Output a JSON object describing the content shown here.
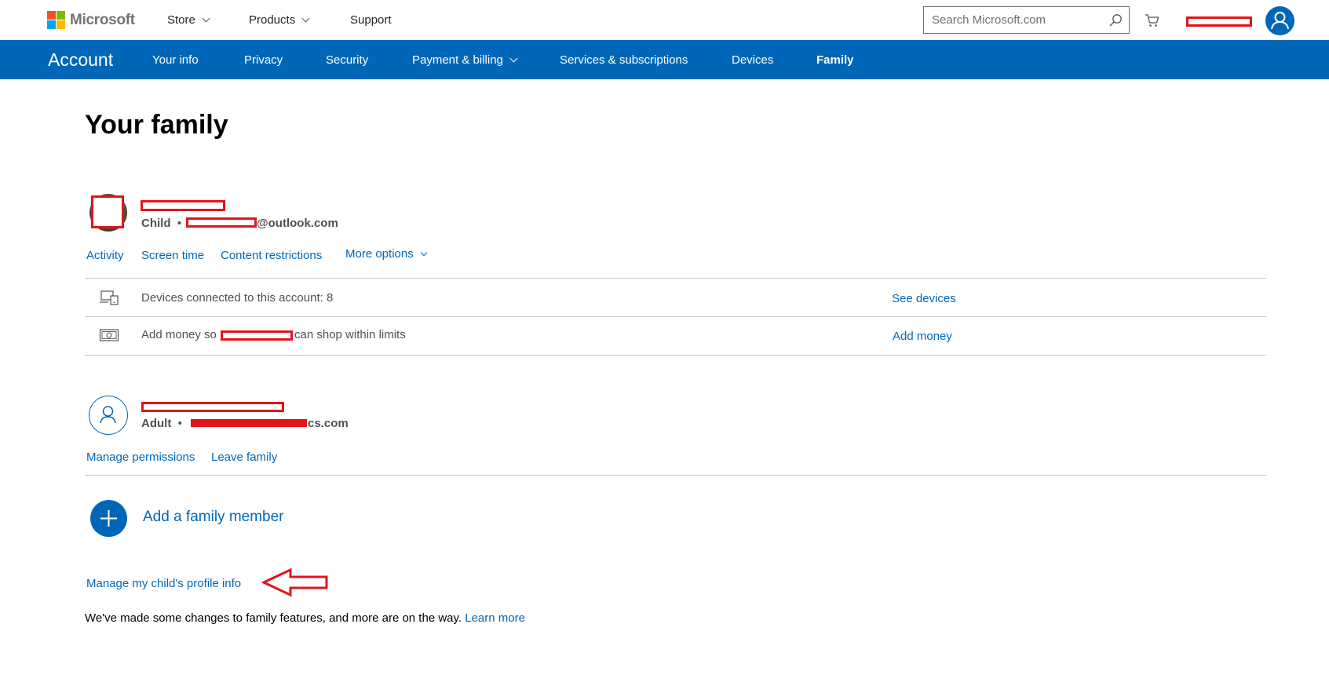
{
  "header": {
    "brand": "Microsoft",
    "nav": [
      {
        "label": "Store",
        "has_dropdown": true
      },
      {
        "label": "Products",
        "has_dropdown": true
      },
      {
        "label": "Support",
        "has_dropdown": false
      }
    ],
    "search_placeholder": "Search Microsoft.com"
  },
  "account_bar": {
    "title": "Account",
    "items": [
      {
        "label": "Your info"
      },
      {
        "label": "Privacy"
      },
      {
        "label": "Security"
      },
      {
        "label": "Payment & billing",
        "has_dropdown": true
      },
      {
        "label": "Services & subscriptions"
      },
      {
        "label": "Devices"
      },
      {
        "label": "Family",
        "active": true
      }
    ]
  },
  "page": {
    "title": "Your family",
    "child_member": {
      "role": "Child",
      "email_domain": "@outlook.com",
      "links": [
        "Activity",
        "Screen time",
        "Content restrictions",
        "More options"
      ],
      "devices_text": "Devices connected to this account: 8",
      "devices_link": "See devices",
      "money_prefix": "Add money so",
      "money_suffix": "can shop within limits",
      "money_link": "Add money"
    },
    "adult_member": {
      "role": "Adult",
      "email_tail": "cs.com",
      "links": [
        "Manage permissions",
        "Leave family"
      ]
    },
    "add_member_label": "Add a family member",
    "manage_profile_link": "Manage my child's profile info",
    "footer_text": "We've made some changes to family features, and more are on the way.",
    "footer_link": "Learn more"
  },
  "colors": {
    "brand_blue": "#0067b8",
    "redaction_red": "#e3141b",
    "logo_red": "#f25022",
    "logo_green": "#7fba00",
    "logo_blue": "#00a4ef",
    "logo_yellow": "#ffb900"
  },
  "icons": [
    "search-icon",
    "cart-icon",
    "user-icon",
    "devices-icon",
    "money-icon",
    "plus-icon",
    "chevron-down-icon"
  ]
}
